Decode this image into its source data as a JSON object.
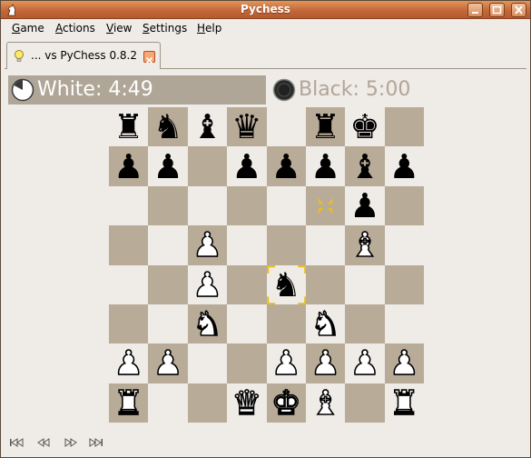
{
  "window": {
    "title": "Pychess"
  },
  "menu": [
    {
      "mnemonic": "G",
      "rest": "ame"
    },
    {
      "mnemonic": "A",
      "rest": "ctions"
    },
    {
      "mnemonic": "V",
      "rest": "iew"
    },
    {
      "mnemonic": "S",
      "rest": "ettings"
    },
    {
      "mnemonic": "H",
      "rest": "elp"
    }
  ],
  "tab": {
    "label": "... vs PyChess 0.8.2"
  },
  "clocks": {
    "white": "White: 4:49",
    "black": "Black: 5:00"
  },
  "board": {
    "rows": [
      [
        "bR",
        "bN",
        "bB",
        "bQ",
        "",
        "bR",
        "bK",
        ""
      ],
      [
        "bP",
        "bP",
        "",
        "bP",
        "bP",
        "bP",
        "bB",
        "bP"
      ],
      [
        "",
        "",
        "",
        "",
        "",
        "",
        "bP",
        ""
      ],
      [
        "",
        "",
        "wP",
        "",
        "",
        "",
        "wB",
        ""
      ],
      [
        "",
        "",
        "wP",
        "",
        "bN",
        "",
        "",
        ""
      ],
      [
        "",
        "",
        "wN",
        "",
        "",
        "wN",
        "",
        ""
      ],
      [
        "wP",
        "wP",
        "",
        "",
        "wP",
        "wP",
        "wP",
        "wP"
      ],
      [
        "wR",
        "",
        "",
        "wQ",
        "wK",
        "wB",
        "",
        "wR"
      ]
    ],
    "last_move": {
      "from": [
        2,
        5
      ],
      "to": [
        4,
        4
      ]
    }
  },
  "navigation": [
    "first-move",
    "previous-move",
    "next-move",
    "last-move"
  ]
}
